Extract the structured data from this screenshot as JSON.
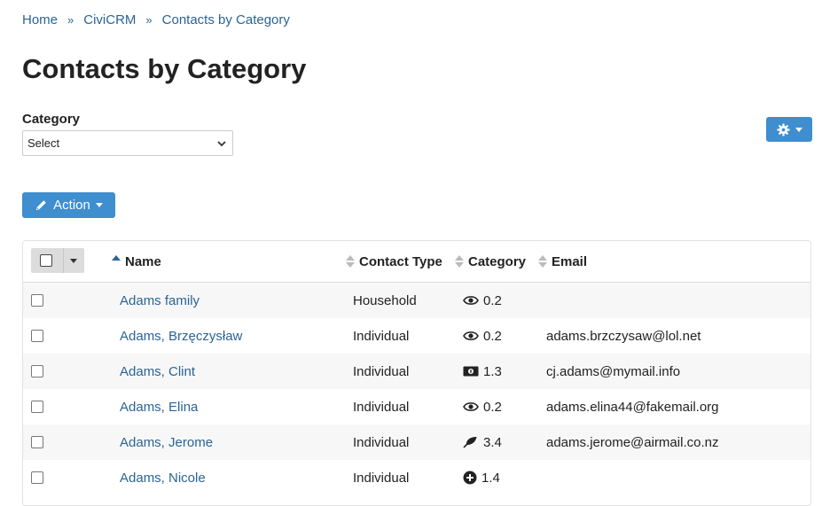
{
  "breadcrumb": {
    "items": [
      "Home",
      "CiviCRM",
      "Contacts by Category"
    ],
    "separator": "»"
  },
  "page": {
    "title": "Contacts by Category"
  },
  "filter": {
    "label": "Category",
    "select_value": "Select"
  },
  "toolbar": {
    "action_label": "Action"
  },
  "colors": {
    "primary": "#3e8ed0",
    "link": "#2a6496"
  },
  "table": {
    "columns": [
      "Name",
      "Contact Type",
      "Category",
      "Email"
    ],
    "rows": [
      {
        "name": "Adams family",
        "type": "Household",
        "category_icon": "eye-icon",
        "category": "0.2",
        "email": ""
      },
      {
        "name": "Adams, Brzęczysław",
        "type": "Individual",
        "category_icon": "eye-icon",
        "category": "0.2",
        "email": "adams.brzczysaw@lol.net"
      },
      {
        "name": "Adams, Clint",
        "type": "Individual",
        "category_icon": "money-bill-icon",
        "category": "1.3",
        "email": "cj.adams@mymail.info"
      },
      {
        "name": "Adams, Elina",
        "type": "Individual",
        "category_icon": "eye-icon",
        "category": "0.2",
        "email": "adams.elina44@fakemail.org"
      },
      {
        "name": "Adams, Jerome",
        "type": "Individual",
        "category_icon": "leaf-icon",
        "category": "3.4",
        "email": "adams.jerome@airmail.co.nz"
      },
      {
        "name": "Adams, Nicole",
        "type": "Individual",
        "category_icon": "plus-circle-icon",
        "category": "1.4",
        "email": ""
      }
    ]
  }
}
